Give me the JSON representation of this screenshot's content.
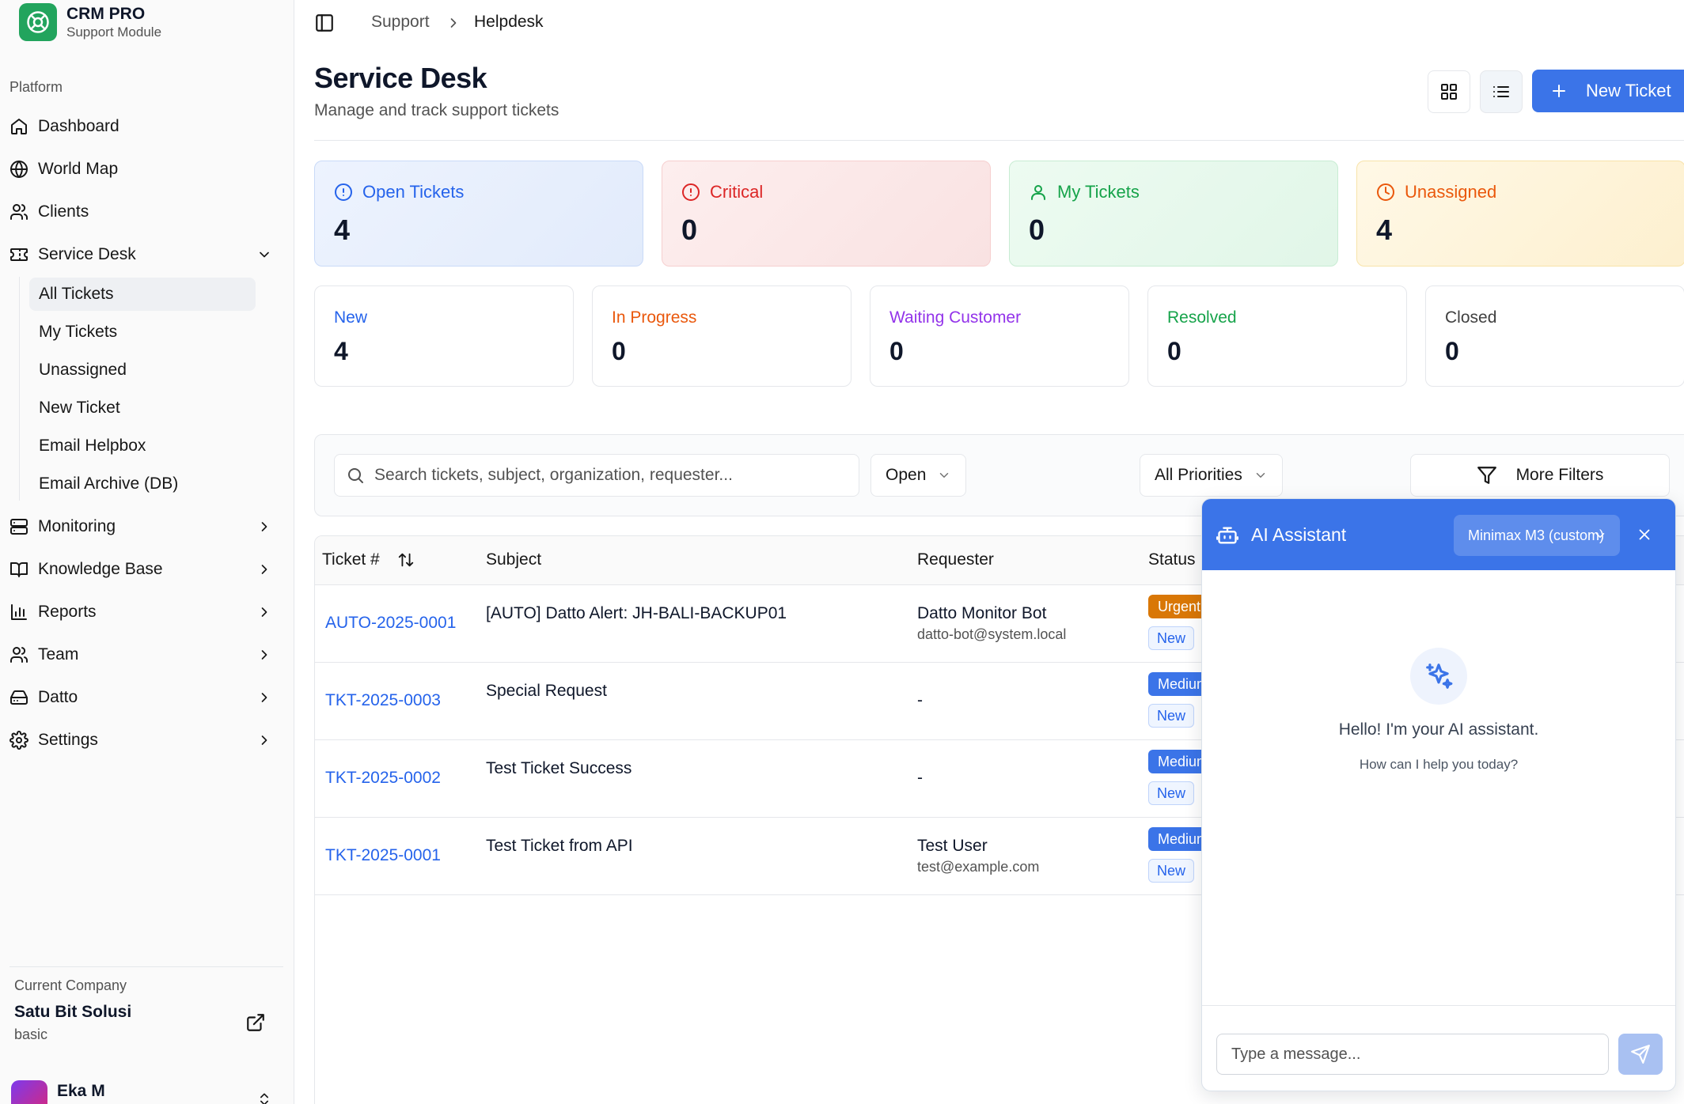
{
  "brand": {
    "title": "CRM PRO",
    "subtitle": "Support Module"
  },
  "sidebar": {
    "section_label": "Platform",
    "items": [
      {
        "label": "Dashboard",
        "icon": "home-icon"
      },
      {
        "label": "World Map",
        "icon": "globe-icon"
      },
      {
        "label": "Clients",
        "icon": "users-icon"
      },
      {
        "label": "Service Desk",
        "icon": "ticket-icon",
        "expanded": true
      },
      {
        "label": "Monitoring",
        "icon": "server-icon"
      },
      {
        "label": "Knowledge Base",
        "icon": "book-icon"
      },
      {
        "label": "Reports",
        "icon": "bar-chart-icon"
      },
      {
        "label": "Team",
        "icon": "users-icon"
      },
      {
        "label": "Datto",
        "icon": "hard-drive-icon"
      },
      {
        "label": "Settings",
        "icon": "gear-icon"
      }
    ],
    "subitems": [
      "All Tickets",
      "My Tickets",
      "Unassigned",
      "New Ticket",
      "Email Helpbox",
      "Email Archive (DB)"
    ],
    "active_subitem": "All Tickets"
  },
  "company": {
    "label": "Current Company",
    "name": "Satu Bit Solusi",
    "plan": "basic"
  },
  "user": {
    "name": "Eka M"
  },
  "breadcrumb": {
    "parent": "Support",
    "current": "Helpdesk"
  },
  "page": {
    "title": "Service Desk",
    "subtitle": "Manage and track support tickets"
  },
  "actions": {
    "new_ticket": "New Ticket",
    "active_view": "list"
  },
  "stats": [
    {
      "label": "Open Tickets",
      "value": "4",
      "icon": "alert-circle-icon",
      "color": "#2563eb"
    },
    {
      "label": "Critical",
      "value": "0",
      "icon": "alert-circle-icon",
      "color": "#dc2626"
    },
    {
      "label": "My Tickets",
      "value": "0",
      "icon": "user-icon",
      "color": "#16a34a"
    },
    {
      "label": "Unassigned",
      "value": "4",
      "icon": "clock-icon",
      "color": "#ea580c"
    }
  ],
  "status_counts": [
    {
      "label": "New",
      "value": "4",
      "color": "#2563eb"
    },
    {
      "label": "In Progress",
      "value": "0",
      "color": "#ea580c"
    },
    {
      "label": "Waiting Customer",
      "value": "0",
      "color": "#9333ea"
    },
    {
      "label": "Resolved",
      "value": "0",
      "color": "#16a34a"
    },
    {
      "label": "Closed",
      "value": "0",
      "color": "#404040"
    }
  ],
  "filters": {
    "search_placeholder": "Search tickets, subject, organization, requester...",
    "status": "Open",
    "priority": "All Priorities",
    "more": "More Filters"
  },
  "table": {
    "headers": {
      "ticket": "Ticket #",
      "subject": "Subject",
      "requester": "Requester",
      "status": "Status"
    },
    "rows": [
      {
        "id": "AUTO-2025-0001",
        "subject": "[AUTO] Datto Alert: JH-BALI-BACKUP01",
        "requester": "Datto Monitor Bot",
        "email": "datto-bot@system.local",
        "priority": "Urgent",
        "priority_color": "#d97706",
        "status": "New"
      },
      {
        "id": "TKT-2025-0003",
        "subject": "Special Request",
        "requester": "-",
        "email": "",
        "priority": "Medium",
        "priority_color": "#3b74e8",
        "status": "New"
      },
      {
        "id": "TKT-2025-0002",
        "subject": "Test Ticket Success",
        "requester": "-",
        "email": "",
        "priority": "Medium",
        "priority_color": "#3b74e8",
        "status": "New"
      },
      {
        "id": "TKT-2025-0001",
        "subject": "Test Ticket from API",
        "requester": "Test User",
        "email": "test@example.com",
        "priority": "Medium",
        "priority_color": "#3b74e8",
        "status": "New"
      }
    ]
  },
  "assistant": {
    "title": "AI Assistant",
    "model": "Minimax M3 (custom)",
    "greeting": "Hello! I'm your AI assistant.",
    "prompt": "How can I help you today?",
    "input_placeholder": "Type a message..."
  }
}
